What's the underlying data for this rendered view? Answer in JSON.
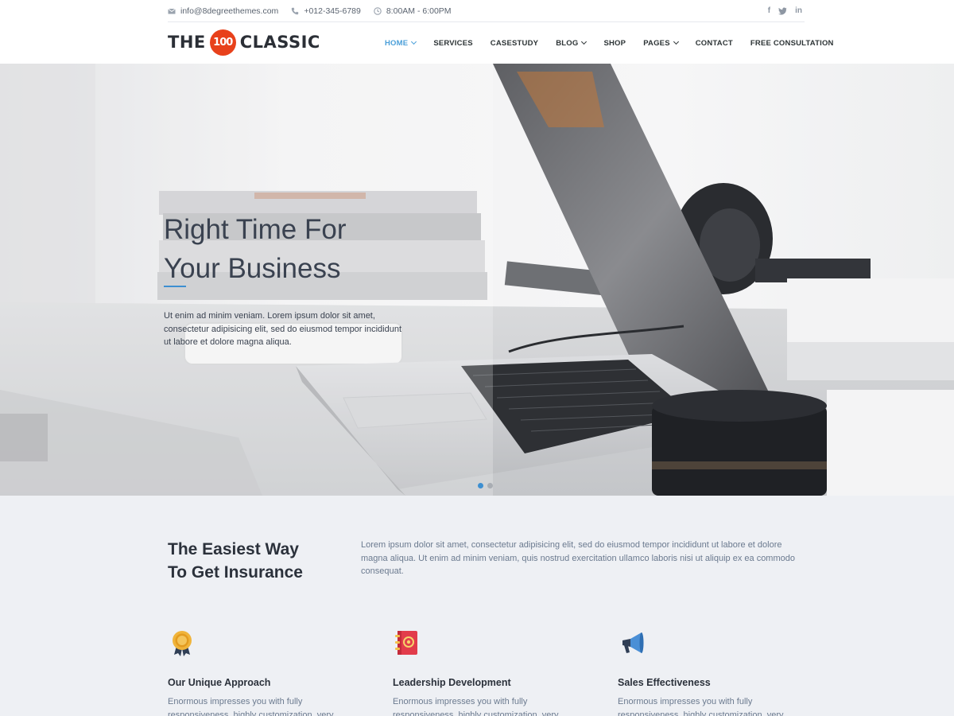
{
  "topbar": {
    "email": "info@8degreethemes.com",
    "phone": "+012-345-6789",
    "hours": "8:00AM - 6:00PM",
    "socials": [
      {
        "icon": "facebook-icon",
        "glyph": "f"
      },
      {
        "icon": "twitter-icon",
        "glyph": "t"
      },
      {
        "icon": "linkedin-icon",
        "glyph": "in"
      }
    ]
  },
  "logo": {
    "left": "THE",
    "badge": "100",
    "right": "CLASSIC",
    "badge_color": "#e8411b"
  },
  "nav": {
    "items": [
      {
        "label": "HOME",
        "dropdown": true,
        "active": true
      },
      {
        "label": "SERVICES",
        "dropdown": false
      },
      {
        "label": "CASESTUDY",
        "dropdown": false
      },
      {
        "label": "BLOG",
        "dropdown": true
      },
      {
        "label": "SHOP",
        "dropdown": false
      },
      {
        "label": "PAGES",
        "dropdown": true
      },
      {
        "label": "CONTACT",
        "dropdown": false
      },
      {
        "label": "FREE CONSULTATION",
        "dropdown": false
      }
    ],
    "accent": "#4a9fd9"
  },
  "hero": {
    "title_line1": "Right Time For",
    "title_line2": "Your Business",
    "text": "Ut enim ad minim veniam. Lorem ipsum dolor sit amet, consectetur adipisicing elit, sed do eiusmod tempor incididunt ut labore et dolore magna aliqua.",
    "slides": 2,
    "active_slide": 1
  },
  "insurance": {
    "title_line1": "The Easiest Way",
    "title_line2": "To Get Insurance",
    "text": "Lorem ipsum dolor sit amet, consectetur adipisicing elit, sed do eiusmod tempor incididunt ut labore et dolore magna aliqua. Ut enim ad minim veniam, quis nostrud exercitation ullamco laboris nisi ut aliquip ex ea commodo consequat."
  },
  "features": [
    {
      "icon": "award-medal-icon",
      "title": "Our Unique Approach",
      "text": "Enormous impresses you with fully responsiveness, highly customization, very"
    },
    {
      "icon": "address-book-icon",
      "title": "Leadership Development",
      "text": "Enormous impresses you with fully responsiveness, highly customization, very"
    },
    {
      "icon": "megaphone-icon",
      "title": "Sales Effectiveness",
      "text": "Enormous impresses you with fully responsiveness, highly customization, very"
    }
  ]
}
